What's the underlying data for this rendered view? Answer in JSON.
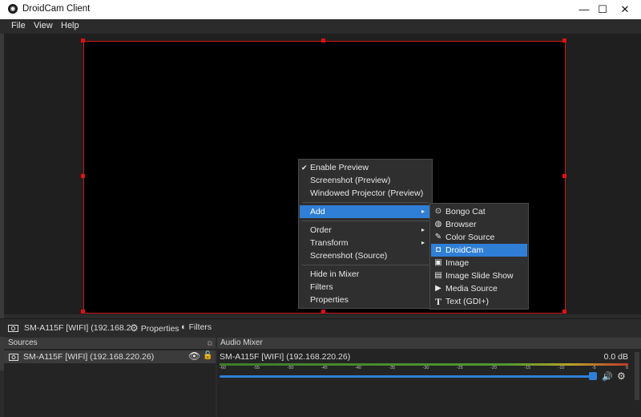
{
  "window": {
    "title": "DroidCam Client",
    "icon": "droidcam-logo-icon",
    "minimize": "—",
    "maximize": "☐",
    "close": "✕"
  },
  "menubar": [
    "File",
    "View",
    "Help"
  ],
  "context_menu": {
    "check_mark": "✔",
    "items": [
      {
        "label": "Enable Preview",
        "checked": true
      },
      {
        "label": "Screenshot (Preview)"
      },
      {
        "label": "Windowed Projector (Preview)"
      },
      {
        "label": "Add",
        "submenu": true,
        "highlighted": true
      },
      {
        "label": "Order",
        "submenu": true
      },
      {
        "label": "Transform",
        "submenu": true
      },
      {
        "label": "Screenshot (Source)"
      },
      {
        "label": "Hide in Mixer"
      },
      {
        "label": "Filters"
      },
      {
        "label": "Properties"
      }
    ],
    "submenu_arrow": "▸"
  },
  "add_submenu": [
    {
      "label": "Bongo Cat",
      "icon": "gamepad-icon",
      "glyph": "⊙"
    },
    {
      "label": "Browser",
      "icon": "globe-icon",
      "glyph": "◍"
    },
    {
      "label": "Color Source",
      "icon": "paint-brush-icon",
      "glyph": "✎"
    },
    {
      "label": "DroidCam",
      "icon": "camera-icon",
      "glyph": "◘",
      "highlighted": true
    },
    {
      "label": "Image",
      "icon": "image-icon",
      "glyph": "▣"
    },
    {
      "label": "Image Slide Show",
      "icon": "slideshow-icon",
      "glyph": "▤"
    },
    {
      "label": "Media Source",
      "icon": "play-icon",
      "glyph": "▶"
    },
    {
      "label": "Text (GDI+)",
      "icon": "text-icon",
      "glyph": "T"
    }
  ],
  "source_toolbar": {
    "source_name": "SM-A115F [WIFI] (192.168.2",
    "properties": "Properties",
    "filters": "Filters"
  },
  "sources_panel": {
    "title": "Sources",
    "items": [
      {
        "label": "SM-A115F [WIFI] (192.168.220.26)",
        "visible": true,
        "locked": false
      }
    ]
  },
  "audio_mixer": {
    "title": "Audio Mixer",
    "channel": "SM-A115F [WIFI] (192.168.220.26)",
    "level": "0.0 dB",
    "volume_fraction": 0.98,
    "ticks": [
      "-60",
      "-55",
      "-50",
      "-45",
      "-40",
      "-35",
      "-30",
      "-25",
      "-20",
      "-15",
      "-10",
      "-5",
      "0"
    ]
  },
  "colors": {
    "accent": "#2f7fd6",
    "selection_border": "#d01818"
  }
}
